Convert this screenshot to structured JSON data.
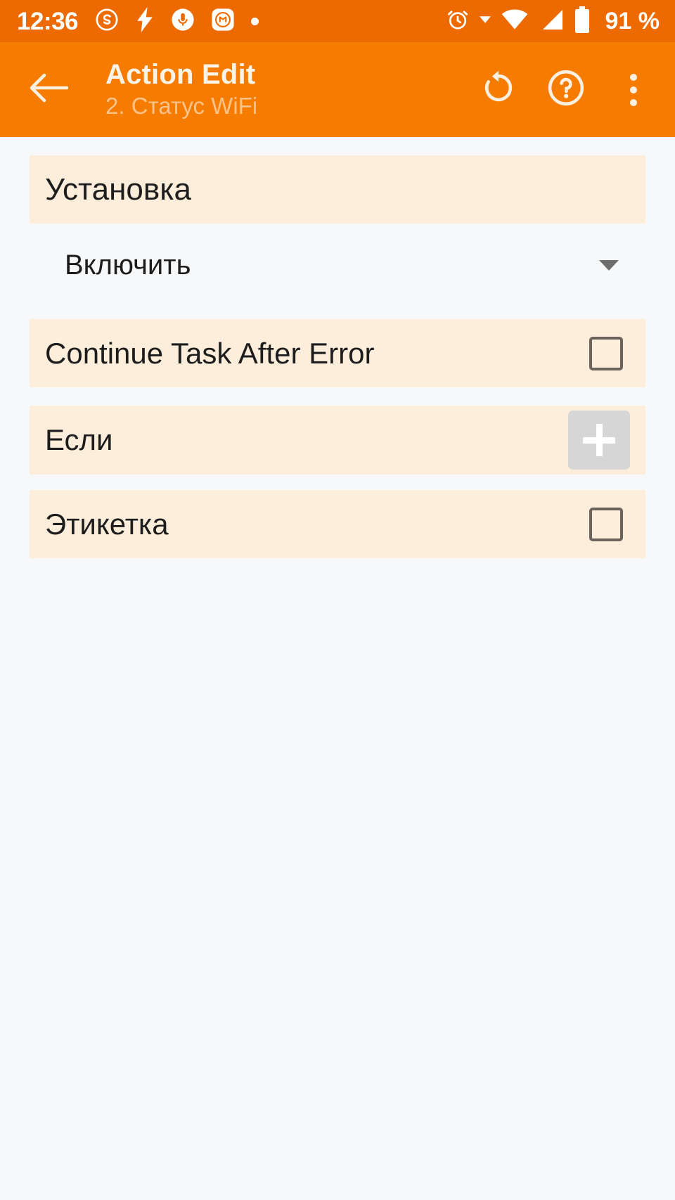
{
  "status_bar": {
    "time": "12:36",
    "battery_text": "91 %",
    "left_icons": [
      "skype-icon",
      "charging-bolt-icon",
      "microphone-icon",
      "mi-app-icon",
      "dot-icon"
    ],
    "right_icons": [
      "alarm-clock-icon",
      "dropdown-triangle-icon",
      "wifi-icon",
      "cellular-signal-icon",
      "battery-icon"
    ],
    "background_color": "#EC6A00",
    "foreground_color": "#FFFFFF"
  },
  "app_bar": {
    "back_icon": "arrow-left-icon",
    "title": "Action Edit",
    "subtitle": "2. Статус WiFi",
    "actions": [
      {
        "name": "reset-icon",
        "label": "Reset"
      },
      {
        "name": "help-icon",
        "label": "Help"
      },
      {
        "name": "overflow-menu-icon",
        "label": "More options"
      }
    ],
    "background_color": "#F57C00",
    "title_color": "#FDF3E6",
    "subtitle_color": "#FBC38A"
  },
  "content": {
    "background_color": "#F7F8FA",
    "row_color": "#FDEEDB",
    "section_header": {
      "label": "Установка"
    },
    "spinner": {
      "value": "Включить",
      "caret_icon": "chevron-down-icon"
    },
    "continue_task": {
      "label": "Continue Task After Error",
      "checked": false
    },
    "if_row": {
      "label": "Если",
      "add_icon": "plus-icon"
    },
    "label_row": {
      "label": "Этикетка",
      "checked": false
    }
  }
}
